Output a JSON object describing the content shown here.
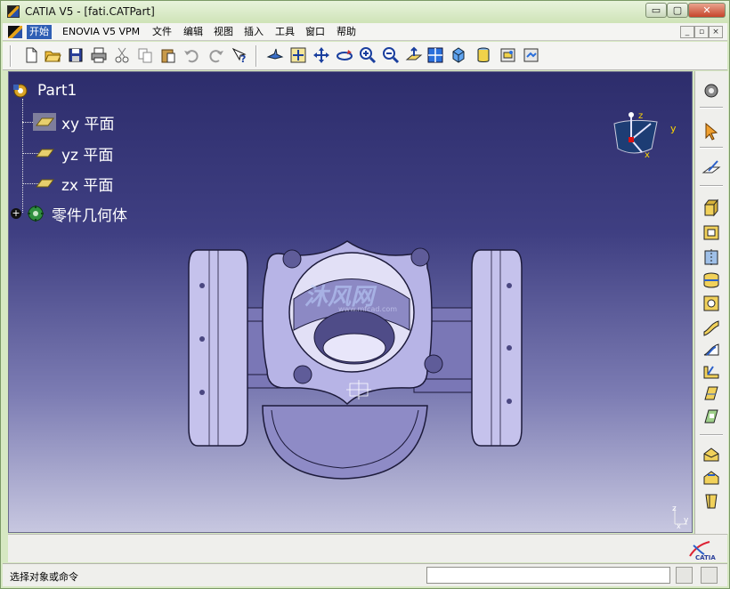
{
  "window": {
    "title": "CATIA V5 - [fati.CATPart]",
    "min_label": "▭",
    "max_label": "▢",
    "close_label": "✕"
  },
  "menu": {
    "items": [
      "开始",
      "ENOVIA V5 VPM",
      "文件",
      "编辑",
      "视图",
      "插入",
      "工具",
      "窗口",
      "帮助"
    ],
    "mdi_min": "_",
    "mdi_restore": "▫",
    "mdi_close": "×"
  },
  "toolbar": {
    "icons": [
      "new-icon",
      "open-icon",
      "save-icon",
      "print-icon",
      "cut-icon",
      "copy-icon",
      "paste-icon",
      "undo-icon",
      "redo-icon",
      "whats-this-icon",
      "fly-mode-icon",
      "fit-all-icon",
      "pan-icon",
      "rotate-icon",
      "zoom-in-icon",
      "zoom-out-icon",
      "normal-view-icon",
      "multi-view-icon",
      "iso-view-icon",
      "shading-icon",
      "hide-show-icon",
      "swap-visible-icon"
    ]
  },
  "tree": {
    "root": "Part1",
    "items": [
      {
        "label": "xy 平面",
        "icon": "plane-icon"
      },
      {
        "label": "yz 平面",
        "icon": "plane-icon"
      },
      {
        "label": "zx 平面",
        "icon": "plane-icon"
      },
      {
        "label": "零件几何体",
        "icon": "part-body-icon"
      }
    ]
  },
  "compass": {
    "z": "z",
    "y": "y",
    "x": "x"
  },
  "mini_axis": {
    "z": "z",
    "y": "y",
    "x": "x"
  },
  "watermark": {
    "text": "沐风网",
    "url": "www.mfcad.com"
  },
  "right_toolbar": {
    "icons": [
      "sketcher-settings-icon",
      "select-arrow-icon",
      "sketch-icon",
      "pad-icon",
      "pocket-icon",
      "shaft-icon",
      "groove-icon",
      "hole-icon",
      "rib-icon",
      "slot-icon",
      "stiffener-icon",
      "multi-section-icon",
      "removed-multi-section-icon",
      "edge-fillet-icon",
      "chamfer-icon",
      "draft-icon"
    ]
  },
  "status": {
    "message": "选择对象或命令",
    "command_value": ""
  },
  "brand": {
    "logo": "CATIA"
  },
  "colors": {
    "viewport_top": "#2d2d6c",
    "viewport_bottom": "#c7c7e0",
    "part_fill": "#a9a6d6",
    "tree_text": "#ffffff"
  }
}
